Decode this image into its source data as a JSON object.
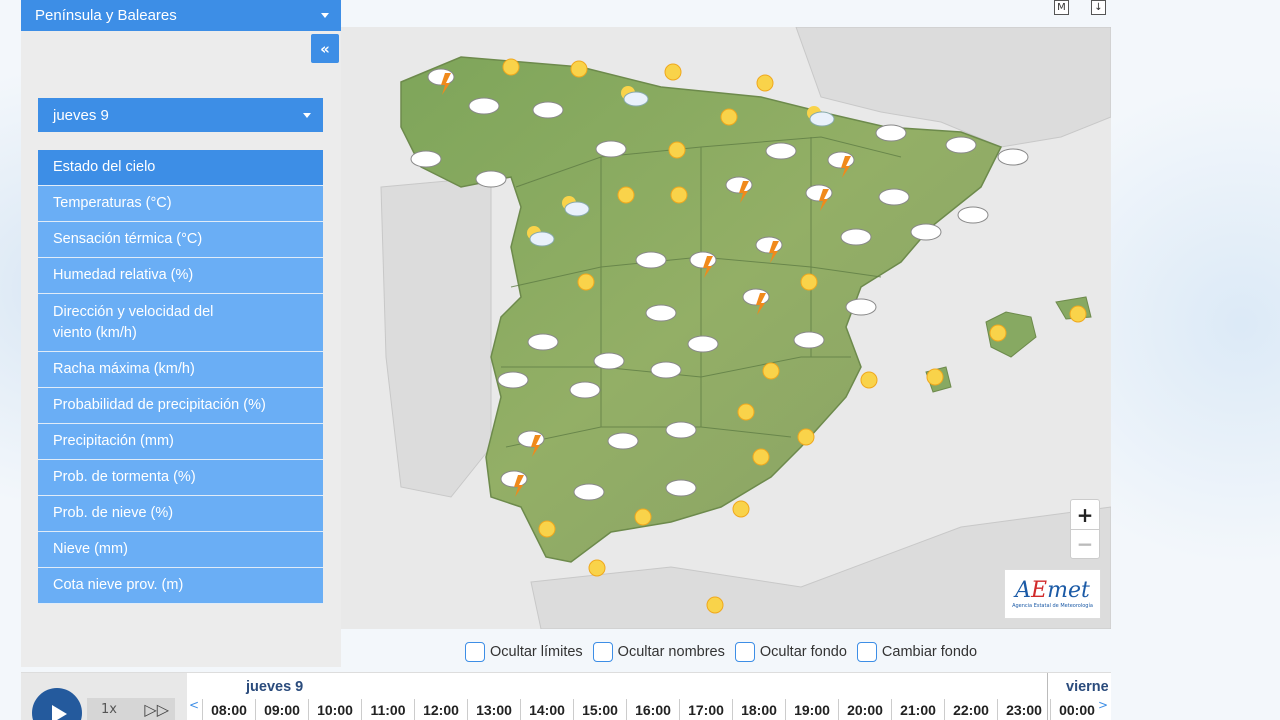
{
  "region": {
    "label": "Península y Baleares"
  },
  "sidebar": {
    "collapse_icon": "«",
    "day": "jueves 9",
    "menu": [
      {
        "label": "Estado del cielo",
        "active": true
      },
      {
        "label": "Temperaturas (°C)"
      },
      {
        "label": "Sensación térmica (°C)"
      },
      {
        "label": "Humedad relativa (%)"
      },
      {
        "label": "Dirección y velocidad del viento (km/h)"
      },
      {
        "label": "Racha máxima (km/h)"
      },
      {
        "label": "Probabilidad de precipitación (%)"
      },
      {
        "label": "Precipitación (mm)"
      },
      {
        "label": "Prob. de tormenta (%)"
      },
      {
        "label": "Prob. de nieve (%)"
      },
      {
        "label": "Nieve (mm)"
      },
      {
        "label": "Cota nieve prov. (m)"
      }
    ]
  },
  "top_icons": {
    "m": "M",
    "download": "↓"
  },
  "map": {
    "zoom_in": "+",
    "zoom_out": "−",
    "logo_main_a": "A",
    "logo_main_e": "E",
    "logo_main_rest": "met",
    "logo_sub": "Agencia Estatal de Meteorología",
    "weather_icons": [
      {
        "type": "storm"
      },
      {
        "type": "sun"
      },
      {
        "type": "sun"
      },
      {
        "type": "sun"
      },
      {
        "type": "sun"
      },
      {
        "type": "cloud"
      },
      {
        "type": "cloud"
      },
      {
        "type": "partly-rain"
      },
      {
        "type": "sun"
      },
      {
        "type": "partly"
      },
      {
        "type": "cloud"
      },
      {
        "type": "cloud"
      },
      {
        "type": "sun"
      },
      {
        "type": "cloud"
      },
      {
        "type": "storm"
      },
      {
        "type": "cloud"
      },
      {
        "type": "cloud"
      },
      {
        "type": "cloud"
      },
      {
        "type": "cloud"
      }
    ]
  },
  "options": [
    {
      "label": "Ocultar límites"
    },
    {
      "label": "Ocultar nombres"
    },
    {
      "label": "Ocultar fondo"
    },
    {
      "label": "Cambiar fondo"
    }
  ],
  "timeline": {
    "day": "jueves 9",
    "next_day": "viernes",
    "speed": "1x",
    "hours": [
      "08:00",
      "09:00",
      "10:00",
      "11:00",
      "12:00",
      "13:00",
      "14:00",
      "15:00",
      "16:00",
      "17:00",
      "18:00",
      "19:00",
      "20:00",
      "21:00",
      "22:00",
      "23:00",
      "00:00"
    ],
    "colors": {
      "accent": "#3d8ee6",
      "play": "#245a9d"
    }
  }
}
